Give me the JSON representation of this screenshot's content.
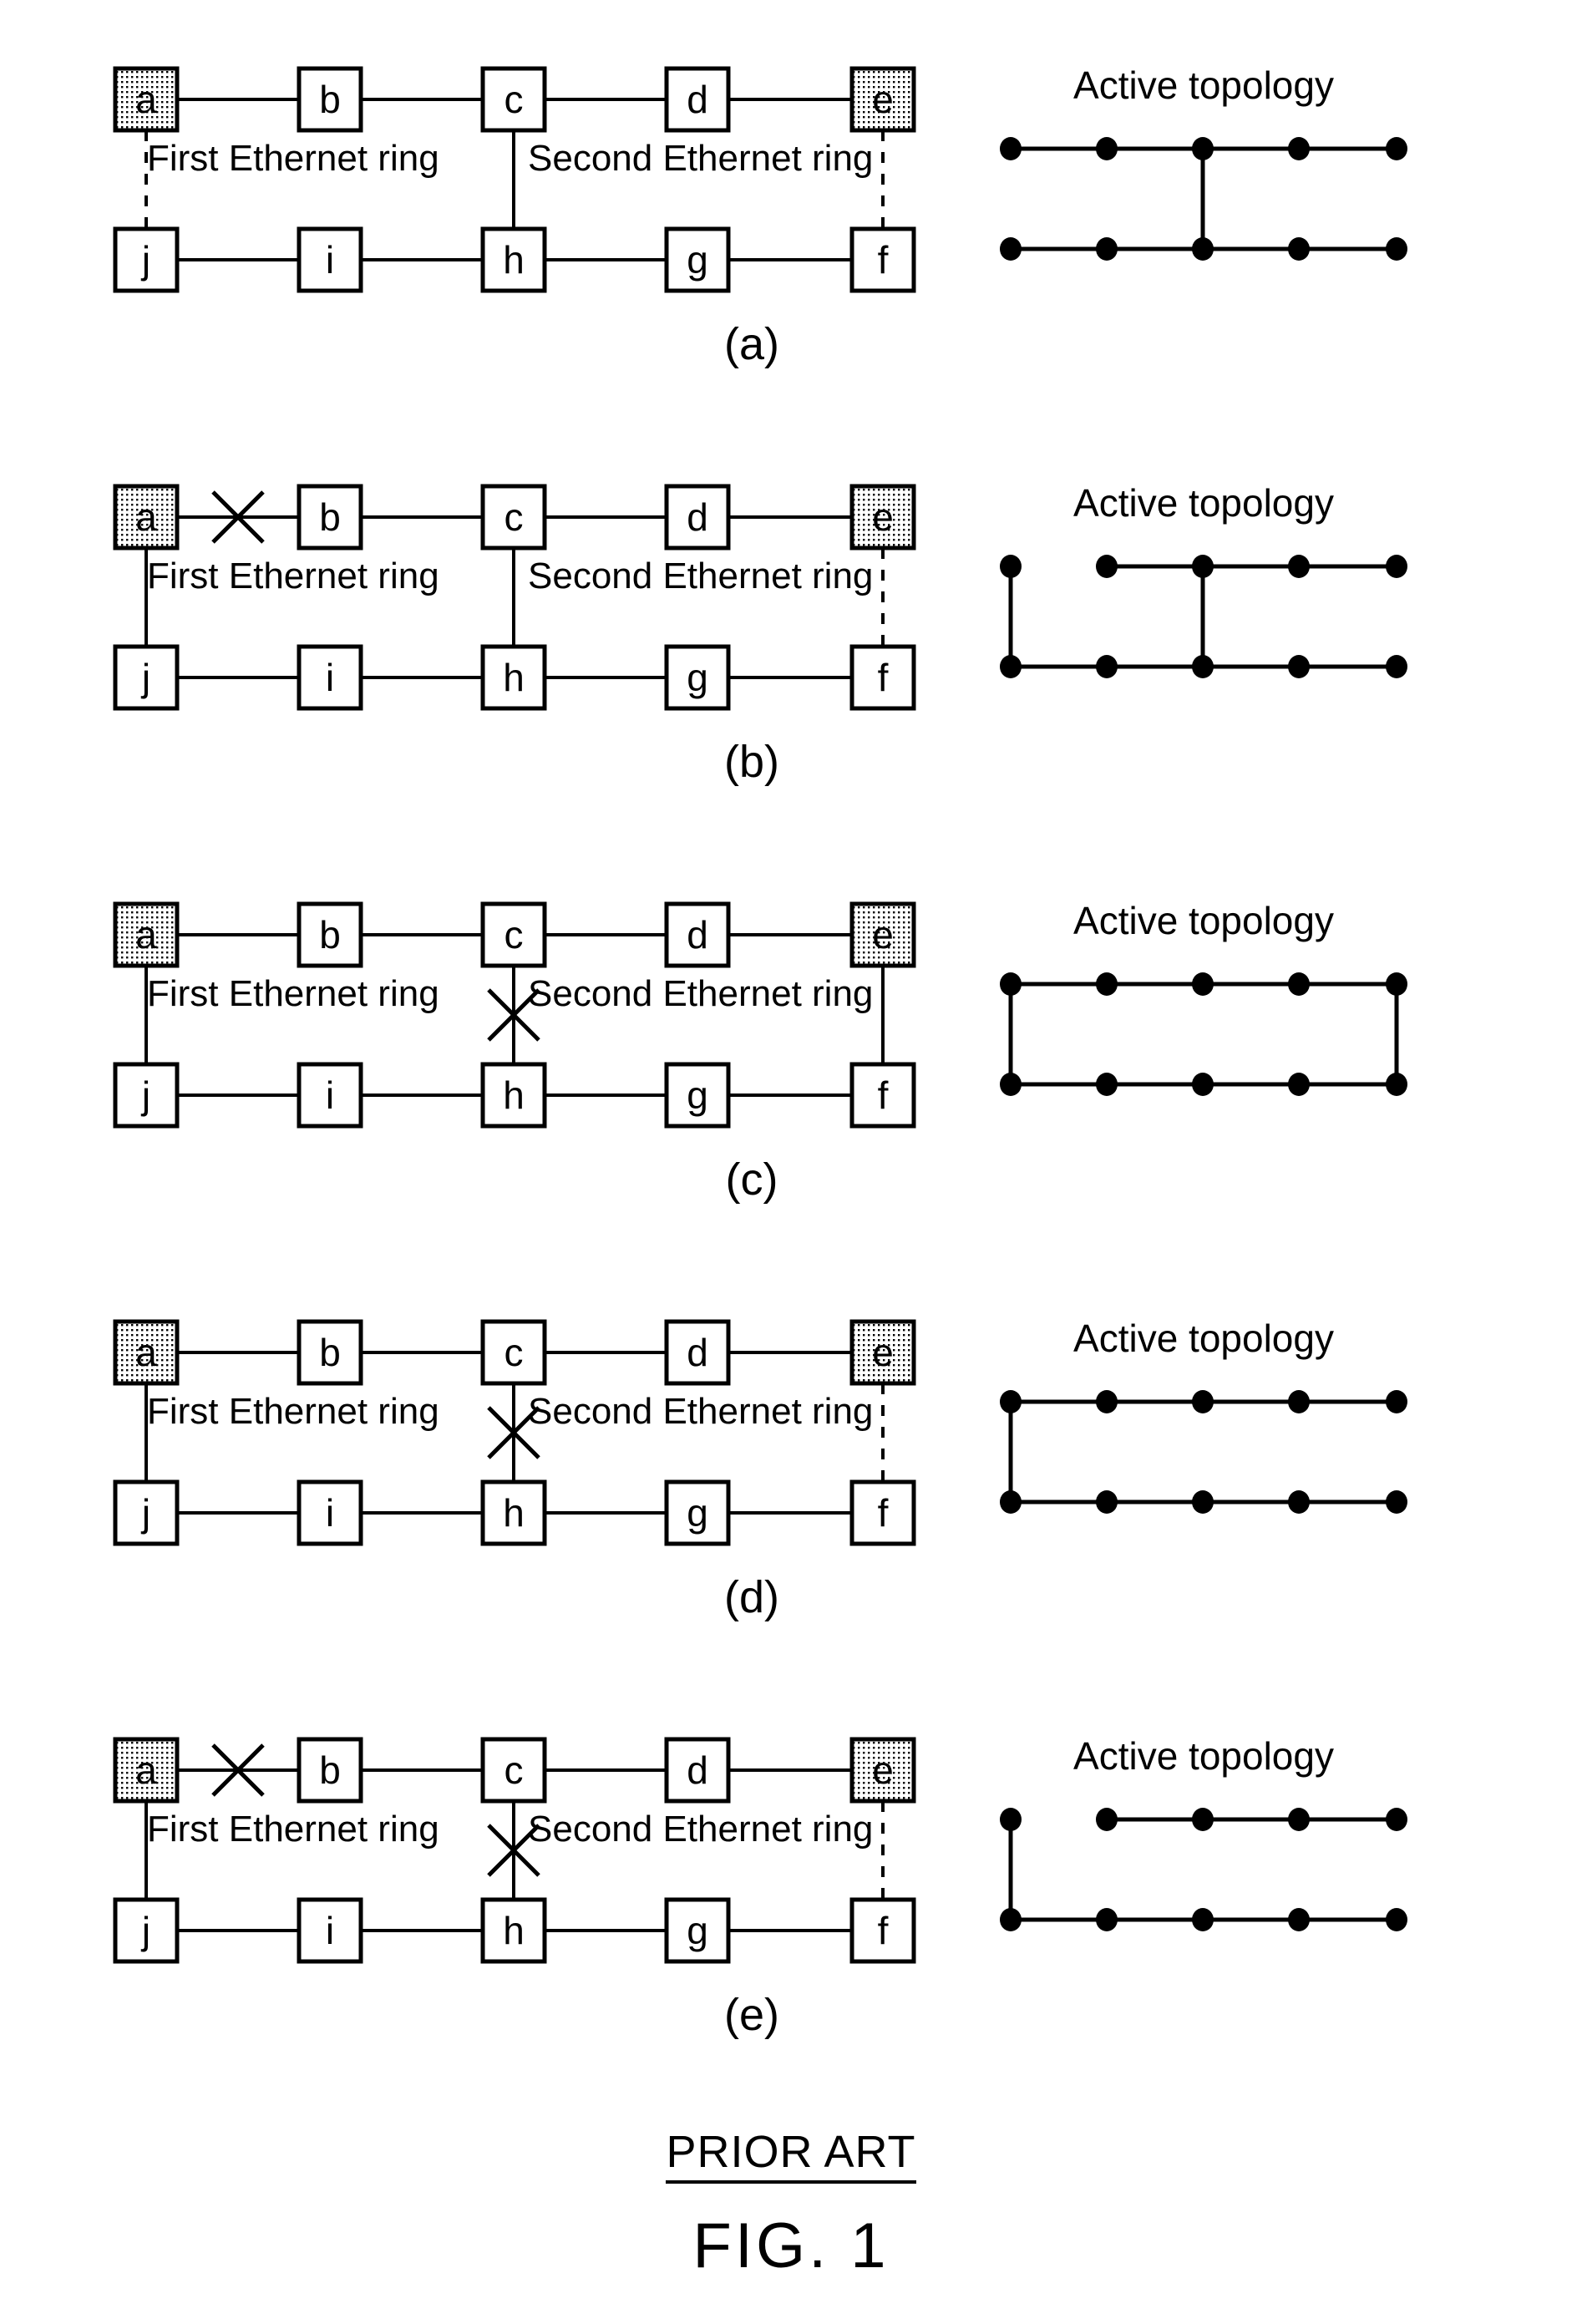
{
  "figure": {
    "prior_art_label": "PRIOR ART",
    "figure_label": "FIG. 1"
  },
  "common": {
    "ring_label_left": "First Ethernet ring",
    "ring_label_right": "Second Ethernet ring",
    "topology_title": "Active topology",
    "top_row_nodes": [
      "a",
      "b",
      "c",
      "d",
      "e"
    ],
    "bottom_row_nodes": [
      "j",
      "i",
      "h",
      "g",
      "f"
    ],
    "shaded_nodes": [
      "a",
      "e"
    ],
    "colors": {
      "line": "#000000",
      "node_fill": "#ffffff",
      "shaded_node_fill": "#d8d8d8",
      "background": "#ffffff"
    }
  },
  "panels": [
    {
      "id": "(a)",
      "topology_title": "Active topology",
      "ring_label_left": "First Ethernet ring",
      "ring_label_right": "Second Ethernet ring",
      "top_row_nodes": [
        "a",
        "b",
        "c",
        "d",
        "e"
      ],
      "bottom_row_nodes": [
        "j",
        "i",
        "h",
        "g",
        "f"
      ],
      "links": {
        "a_b": "solid",
        "b_c": "solid",
        "c_d": "solid",
        "d_e": "solid",
        "j_i": "solid",
        "i_h": "solid",
        "h_g": "solid",
        "g_f": "solid",
        "a_j": "dashed",
        "c_h": "solid",
        "e_f": "dashed"
      },
      "breaks": [],
      "active_topology": {
        "top_segments": [
          "a-b",
          "b-c",
          "c-d",
          "d-e"
        ],
        "bottom_segments": [
          "j-i",
          "i-h",
          "h-g",
          "g-f"
        ],
        "verticals": [
          "c-h"
        ]
      }
    },
    {
      "id": "(b)",
      "topology_title": "Active topology",
      "ring_label_left": "First Ethernet ring",
      "ring_label_right": "Second Ethernet ring",
      "top_row_nodes": [
        "a",
        "b",
        "c",
        "d",
        "e"
      ],
      "bottom_row_nodes": [
        "j",
        "i",
        "h",
        "g",
        "f"
      ],
      "links": {
        "a_b": "solid",
        "b_c": "solid",
        "c_d": "solid",
        "d_e": "solid",
        "j_i": "solid",
        "i_h": "solid",
        "h_g": "solid",
        "g_f": "solid",
        "a_j": "solid",
        "c_h": "solid",
        "e_f": "dashed"
      },
      "breaks": [
        "a_b"
      ],
      "active_topology": {
        "top_segments": [
          "b-c",
          "c-d",
          "d-e"
        ],
        "bottom_segments": [
          "j-i",
          "i-h",
          "h-g",
          "g-f"
        ],
        "verticals": [
          "a-j",
          "c-h"
        ]
      }
    },
    {
      "id": "(c)",
      "topology_title": "Active topology",
      "ring_label_left": "First Ethernet ring",
      "ring_label_right": "Second Ethernet ring",
      "top_row_nodes": [
        "a",
        "b",
        "c",
        "d",
        "e"
      ],
      "bottom_row_nodes": [
        "j",
        "i",
        "h",
        "g",
        "f"
      ],
      "links": {
        "a_b": "solid",
        "b_c": "solid",
        "c_d": "solid",
        "d_e": "solid",
        "j_i": "solid",
        "i_h": "solid",
        "h_g": "solid",
        "g_f": "solid",
        "a_j": "solid",
        "c_h": "solid",
        "e_f": "solid"
      },
      "breaks": [
        "c_h"
      ],
      "active_topology": {
        "top_segments": [
          "a-b",
          "b-c",
          "c-d",
          "d-e"
        ],
        "bottom_segments": [
          "j-i",
          "i-h",
          "h-g",
          "g-f"
        ],
        "verticals": [
          "a-j",
          "e-f"
        ]
      }
    },
    {
      "id": "(d)",
      "topology_title": "Active topology",
      "ring_label_left": "First Ethernet ring",
      "ring_label_right": "Second Ethernet ring",
      "top_row_nodes": [
        "a",
        "b",
        "c",
        "d",
        "e"
      ],
      "bottom_row_nodes": [
        "j",
        "i",
        "h",
        "g",
        "f"
      ],
      "links": {
        "a_b": "solid",
        "b_c": "solid",
        "c_d": "solid",
        "d_e": "solid",
        "j_i": "solid",
        "i_h": "solid",
        "h_g": "solid",
        "g_f": "solid",
        "a_j": "solid",
        "c_h": "solid",
        "e_f": "dashed"
      },
      "breaks": [
        "c_h"
      ],
      "active_topology": {
        "top_segments": [
          "a-b",
          "b-c",
          "c-d",
          "d-e"
        ],
        "bottom_segments": [
          "j-i",
          "i-h",
          "h-g",
          "g-f"
        ],
        "verticals": [
          "a-j"
        ]
      }
    },
    {
      "id": "(e)",
      "topology_title": "Active topology",
      "ring_label_left": "First Ethernet ring",
      "ring_label_right": "Second Ethernet ring",
      "top_row_nodes": [
        "a",
        "b",
        "c",
        "d",
        "e"
      ],
      "bottom_row_nodes": [
        "j",
        "i",
        "h",
        "g",
        "f"
      ],
      "links": {
        "a_b": "solid",
        "b_c": "solid",
        "c_d": "solid",
        "d_e": "solid",
        "j_i": "solid",
        "i_h": "solid",
        "h_g": "solid",
        "g_f": "solid",
        "a_j": "solid",
        "c_h": "solid",
        "e_f": "dashed"
      },
      "breaks": [
        "a_b",
        "c_h"
      ],
      "active_topology": {
        "top_segments": [
          "b-c",
          "c-d",
          "d-e"
        ],
        "bottom_segments": [
          "j-i",
          "i-h",
          "h-g",
          "g-f"
        ],
        "verticals": [
          "a-j"
        ]
      }
    }
  ]
}
